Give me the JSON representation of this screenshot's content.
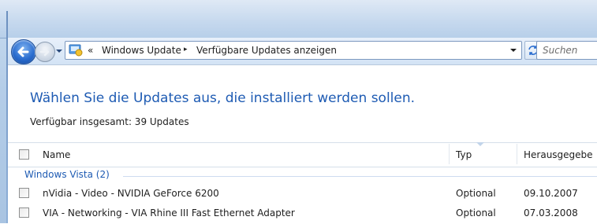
{
  "address_bar": {
    "overflow_glyph": "«",
    "crumbs": [
      "Windows Update",
      "Verfügbare Updates anzeigen"
    ],
    "separator_glyph": "▸"
  },
  "search": {
    "placeholder": "Suchen"
  },
  "main": {
    "heading": "Wählen Sie die Updates aus, die installiert werden sollen.",
    "subtitle": "Verfügbar insgesamt: 39 Updates"
  },
  "table": {
    "columns": {
      "name": "Name",
      "type": "Typ",
      "publisher": "Herausgegebe"
    },
    "group": "Windows Vista (2)",
    "rows": [
      {
        "name": "nVidia - Video - NVIDIA GeForce 6200",
        "type": "Optional",
        "date": "09.10.2007",
        "checked": false
      },
      {
        "name": "VIA - Networking - VIA Rhine III Fast Ethernet Adapter",
        "type": "Optional",
        "date": "07.03.2008",
        "checked": false
      }
    ]
  },
  "colors": {
    "accent": "#1e5bb3",
    "frame": "#b4cde8",
    "nav_button": "#2a6dd0"
  }
}
